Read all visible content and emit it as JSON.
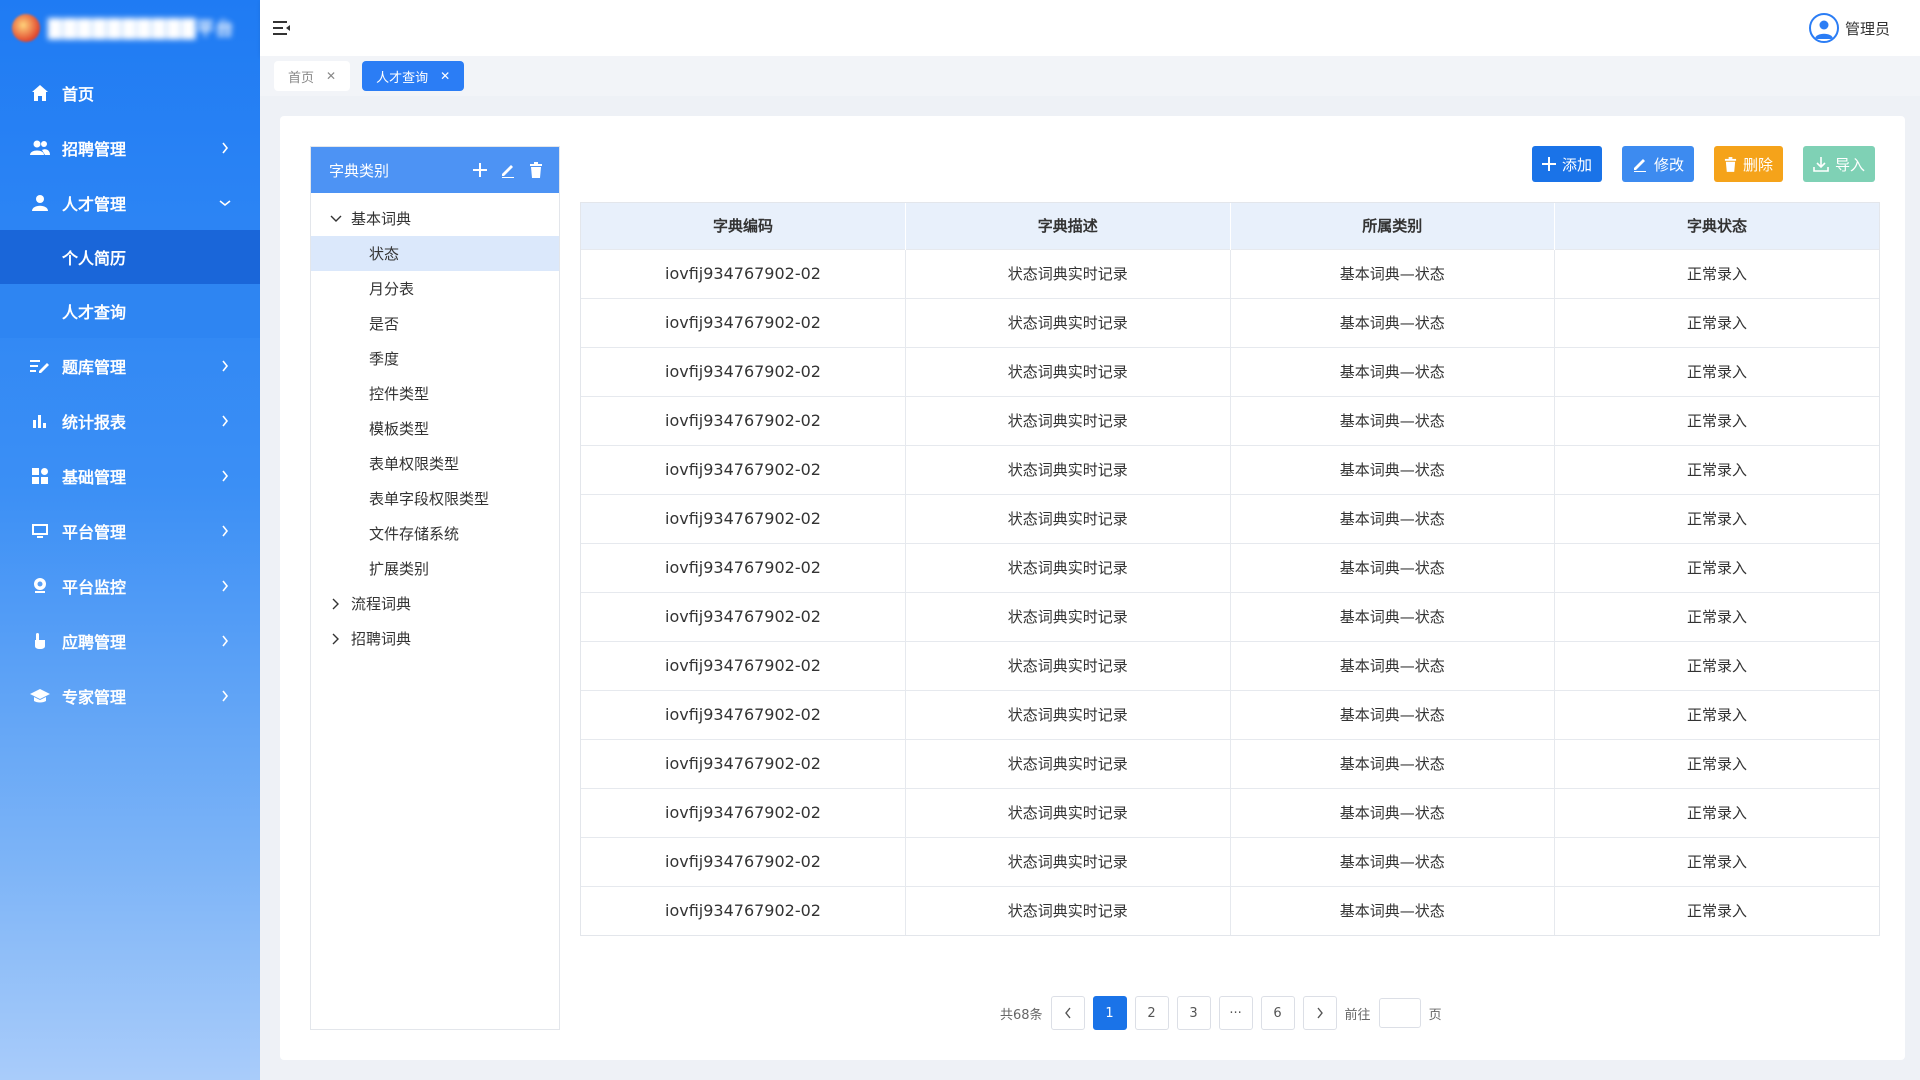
{
  "header": {
    "user_name": "管理员"
  },
  "sidebar": {
    "items": [
      {
        "label": "首页",
        "icon": "home-icon"
      },
      {
        "label": "招聘管理",
        "icon": "users-icon"
      },
      {
        "label": "人才管理",
        "icon": "user-icon",
        "expanded": true,
        "children": [
          {
            "label": "个人简历",
            "active": true
          },
          {
            "label": "人才查询"
          }
        ]
      },
      {
        "label": "题库管理",
        "icon": "edit-list-icon"
      },
      {
        "label": "统计报表",
        "icon": "bar-chart-icon"
      },
      {
        "label": "基础管理",
        "icon": "grid-icon"
      },
      {
        "label": "平台管理",
        "icon": "monitor-icon"
      },
      {
        "label": "平台监控",
        "icon": "camera-icon"
      },
      {
        "label": "应聘管理",
        "icon": "hand-icon"
      },
      {
        "label": "专家管理",
        "icon": "graduation-cap-icon"
      }
    ]
  },
  "tabs": [
    {
      "label": "首页",
      "active": false
    },
    {
      "label": "人才查询",
      "active": true
    }
  ],
  "tree": {
    "title": "字典类别",
    "nodes": [
      {
        "label": "基本词典",
        "expanded": true,
        "children": [
          "状态",
          "月分表",
          "是否",
          "季度",
          "控件类型",
          "模板类型",
          "表单权限类型",
          "表单字段权限类型",
          "文件存储系统",
          "扩展类别"
        ]
      },
      {
        "label": "流程词典",
        "expanded": false
      },
      {
        "label": "招聘词典",
        "expanded": false
      }
    ],
    "selected": "状态"
  },
  "toolbar": {
    "add": "添加",
    "edit": "修改",
    "delete": "删除",
    "import": "导入"
  },
  "table": {
    "headers": [
      "字典编码",
      "字典描述",
      "所属类别",
      "字典状态"
    ],
    "rows": [
      [
        "iovfij934767902-02",
        "状态词典实时记录",
        "基本词典—状态",
        "正常录入"
      ],
      [
        "iovfij934767902-02",
        "状态词典实时记录",
        "基本词典—状态",
        "正常录入"
      ],
      [
        "iovfij934767902-02",
        "状态词典实时记录",
        "基本词典—状态",
        "正常录入"
      ],
      [
        "iovfij934767902-02",
        "状态词典实时记录",
        "基本词典—状态",
        "正常录入"
      ],
      [
        "iovfij934767902-02",
        "状态词典实时记录",
        "基本词典—状态",
        "正常录入"
      ],
      [
        "iovfij934767902-02",
        "状态词典实时记录",
        "基本词典—状态",
        "正常录入"
      ],
      [
        "iovfij934767902-02",
        "状态词典实时记录",
        "基本词典—状态",
        "正常录入"
      ],
      [
        "iovfij934767902-02",
        "状态词典实时记录",
        "基本词典—状态",
        "正常录入"
      ],
      [
        "iovfij934767902-02",
        "状态词典实时记录",
        "基本词典—状态",
        "正常录入"
      ],
      [
        "iovfij934767902-02",
        "状态词典实时记录",
        "基本词典—状态",
        "正常录入"
      ],
      [
        "iovfij934767902-02",
        "状态词典实时记录",
        "基本词典—状态",
        "正常录入"
      ],
      [
        "iovfij934767902-02",
        "状态词典实时记录",
        "基本词典—状态",
        "正常录入"
      ],
      [
        "iovfij934767902-02",
        "状态词典实时记录",
        "基本词典—状态",
        "正常录入"
      ],
      [
        "iovfij934767902-02",
        "状态词典实时记录",
        "基本词典—状态",
        "正常录入"
      ]
    ]
  },
  "pager": {
    "total": "共68条",
    "pages": [
      "1",
      "2",
      "3",
      "···",
      "6"
    ],
    "current": "1",
    "goto_prefix": "前往",
    "goto_suffix": "页"
  },
  "colors": {
    "primary": "#1a73e8",
    "warning": "#f5a31a",
    "success": "#7fd1b5"
  }
}
